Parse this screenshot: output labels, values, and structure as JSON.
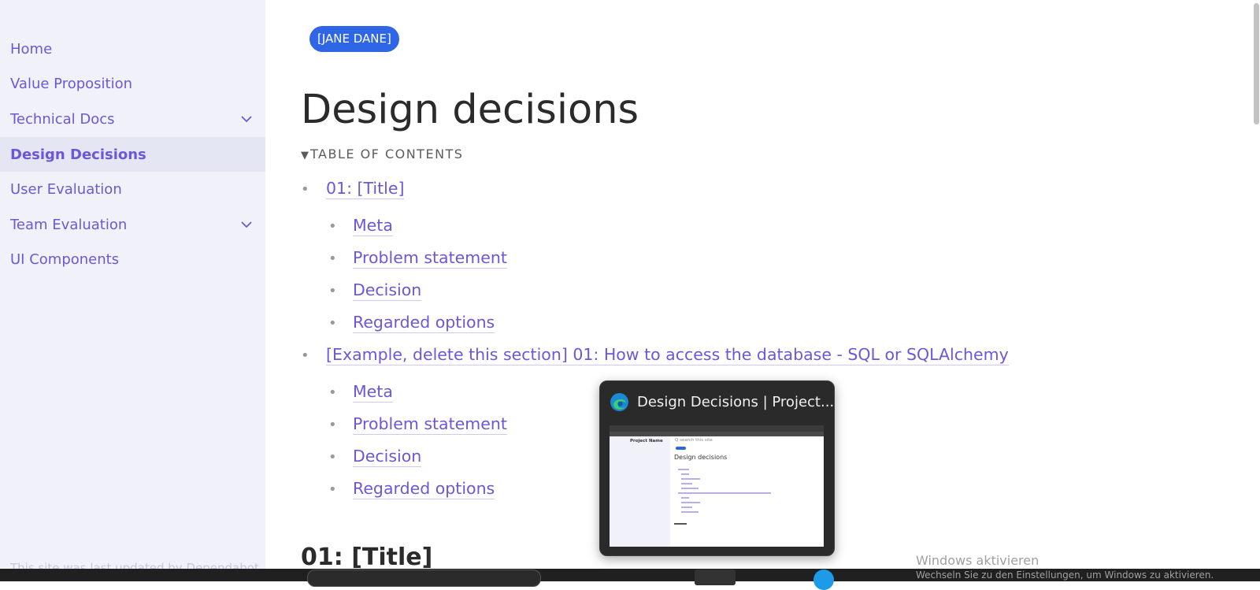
{
  "sidebar": {
    "items": [
      {
        "label": "Home",
        "expandable": false,
        "active": false
      },
      {
        "label": "Value Proposition",
        "expandable": false,
        "active": false
      },
      {
        "label": "Technical Docs",
        "expandable": true,
        "active": false
      },
      {
        "label": "Design Decisions",
        "expandable": false,
        "active": true
      },
      {
        "label": "User Evaluation",
        "expandable": false,
        "active": false
      },
      {
        "label": "Team Evaluation",
        "expandable": true,
        "active": false
      },
      {
        "label": "UI Components",
        "expandable": false,
        "active": false
      }
    ],
    "footer_text": "This site was last updated by Dependabot"
  },
  "main": {
    "badge": "[JANE DANE]",
    "title": "Design decisions",
    "toc_label": "TABLE OF CONTENTS",
    "toc": [
      {
        "label": "01: [Title]",
        "children": [
          "Meta",
          "Problem statement",
          "Decision",
          "Regarded options"
        ]
      },
      {
        "label": "[Example, delete this section] 01: How to access the database - SQL or SQLAlchemy",
        "children": [
          "Meta",
          "Problem statement",
          "Decision",
          "Regarded options"
        ]
      }
    ],
    "section_title": "01: [Title]"
  },
  "preview": {
    "title": "Design Decisions | Project...",
    "thumb": {
      "sidebar_title": "Project Name",
      "search": "Q search this site",
      "heading": "Design decisions"
    }
  },
  "windows_activation": {
    "title": "Windows aktivieren",
    "message": "Wechseln Sie zu den Einstellungen, um Windows zu aktivieren."
  },
  "colors": {
    "accent": "#6d57d6",
    "badge": "#2f66e6",
    "sidebar_bg": "#f1f2f9"
  }
}
